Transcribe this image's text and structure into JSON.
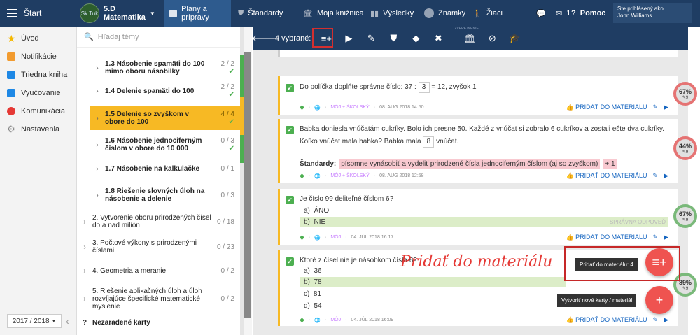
{
  "topbar": {
    "start_label": "Štart",
    "class_name": "5.D",
    "subject": "Matematika",
    "logo_text": "Sk Tuk",
    "nav": [
      {
        "label": "Plány a prípravy",
        "icon": "folder-icon",
        "active": true
      },
      {
        "label": "Štandardy",
        "icon": "shield-icon"
      },
      {
        "label": "Moja knižnica",
        "icon": "library-icon"
      },
      {
        "label": "Výsledky",
        "icon": "chart-icon"
      },
      {
        "label": "Známky",
        "icon": "grades-icon"
      },
      {
        "label": "Žiaci",
        "icon": "students-icon"
      }
    ],
    "chat_icon": "chat-icon",
    "mail_count": "1",
    "help_label": "Pomoc",
    "user_label": "Ste prihlásený ako",
    "user_name": "John Williams"
  },
  "leftnav": {
    "items": [
      {
        "label": "Úvod",
        "icon": "star-icon",
        "color": "#f5b800"
      },
      {
        "label": "Notifikácie",
        "icon": "mail-icon",
        "color": "#f29b2f"
      },
      {
        "label": "Triedna kniha",
        "icon": "book-icon",
        "color": "#1e88e5"
      },
      {
        "label": "Vyučovanie",
        "icon": "teaching-icon",
        "color": "#1e88e5"
      },
      {
        "label": "Komunikácia",
        "icon": "chat-bubble-icon",
        "color": "#e53935"
      },
      {
        "label": "Nastavenia",
        "icon": "gear-icon",
        "color": "#888888"
      }
    ],
    "year": "2017 / 2018"
  },
  "topics": {
    "search_placeholder": "Hľadaj témy",
    "items": [
      {
        "label": "1.3  Násobenie spamäti do 100 mimo oboru násobilky",
        "count": "2 / 2",
        "done": true
      },
      {
        "label": "1.4  Delenie spamäti do 100",
        "count": "2 / 2",
        "done": true
      },
      {
        "label": "1.5  Delenie so zvyškom v obore do 100",
        "count": "4 / 4",
        "done": true,
        "highlight": true
      },
      {
        "label": "1.6  Násobenie jednociferným číslom v obore do 10 000",
        "count": "0 / 3",
        "done": true
      },
      {
        "label": "1.7  Násobenie na kalkulačke",
        "count": "0 / 1"
      },
      {
        "label": "1.8  Riešenie slovných úloh na násobenie a delenie",
        "count": "0 / 3"
      },
      {
        "label": "2. Vytvorenie oboru prirodzených čísel do a nad milión",
        "count": "0 / 18"
      },
      {
        "label": "3. Počtové výkony s prirodzenými číslami",
        "count": "0 / 23"
      },
      {
        "label": "4. Geometria a meranie",
        "count": "0 / 2"
      },
      {
        "label": "5. Riešenie aplikačných úloh a úloh rozvíjajúce špecifické matematické myslenie",
        "count": "0 / 2"
      },
      {
        "label": "Nezaradené karty",
        "count": ""
      }
    ]
  },
  "toolbar": {
    "selected": "4 vybrané:",
    "verified_label": "ZVEREJNENIE"
  },
  "cards": [
    {
      "question_pre": "Do políčka doplňte správne číslo: 37 :",
      "answer": "3",
      "question_post": "= 12, zvyšok 1",
      "meta_source": "MÔJ + ŠKOLSKÝ",
      "meta_date": "08. AUG 2018 14:50",
      "add_label": "PRIDAŤ DO MATERIÁLU",
      "gauge": "67%",
      "gauge_sub": "9"
    },
    {
      "question_pre": "Babka doniesla vnúčatám cukríky. Bolo ich presne 50. Každé z vnúčat si zobralo 6 cukríkov a zostali ešte dva cukríky. Koľko vnúčat mala babka? Babka mala",
      "answer": "8",
      "question_post": "vnúčat.",
      "standards_label": "Štandardy:",
      "standard": "písomne vynásobiť a vydeliť prirodzené čísla jednociferným číslom (aj so zvyškom)",
      "standard_more": "+ 1",
      "meta_source": "MÔJ + ŠKOLSKÝ",
      "meta_date": "08. AUG 2018 12:58",
      "add_label": "PRIDAŤ DO MATERIÁLU",
      "gauge": "44%",
      "gauge_sub": "9"
    },
    {
      "question": "Je číslo 99 deliteľné číslom 6?",
      "options": [
        {
          "key": "a)",
          "text": "ÁNO"
        },
        {
          "key": "b)",
          "text": "NIE",
          "correct": true
        }
      ],
      "correct_label": "SPRÁVNA ODPOVEĎ",
      "meta_source": "MÔJ",
      "meta_date": "04. JÚL 2018 16:17",
      "add_label": "PRIDAŤ DO MATERIÁLU",
      "gauge": "67%",
      "gauge_sub": "9"
    },
    {
      "question": "Ktoré z čísel nie je násobkom čísla 6?",
      "options": [
        {
          "key": "a)",
          "text": "36"
        },
        {
          "key": "b)",
          "text": "78",
          "correct": true
        },
        {
          "key": "c)",
          "text": "81"
        },
        {
          "key": "d)",
          "text": "54"
        }
      ],
      "meta_source": "MÔJ",
      "meta_date": "04. JÚL 2018 16:09",
      "add_label": "PRIDAŤ DO MATERIÁLU",
      "gauge": "89%",
      "gauge_sub": "9"
    }
  ],
  "fab": {
    "add_to_material": "Pridať do materiálu: 4",
    "new_cards": "Vytvoriť nové karty / materiál"
  },
  "annotation": "Pridať do materiálu",
  "colors": {
    "navy": "#1f3d63",
    "accent": "#f7b924",
    "red": "#ef5350",
    "green": "#4caf50"
  }
}
